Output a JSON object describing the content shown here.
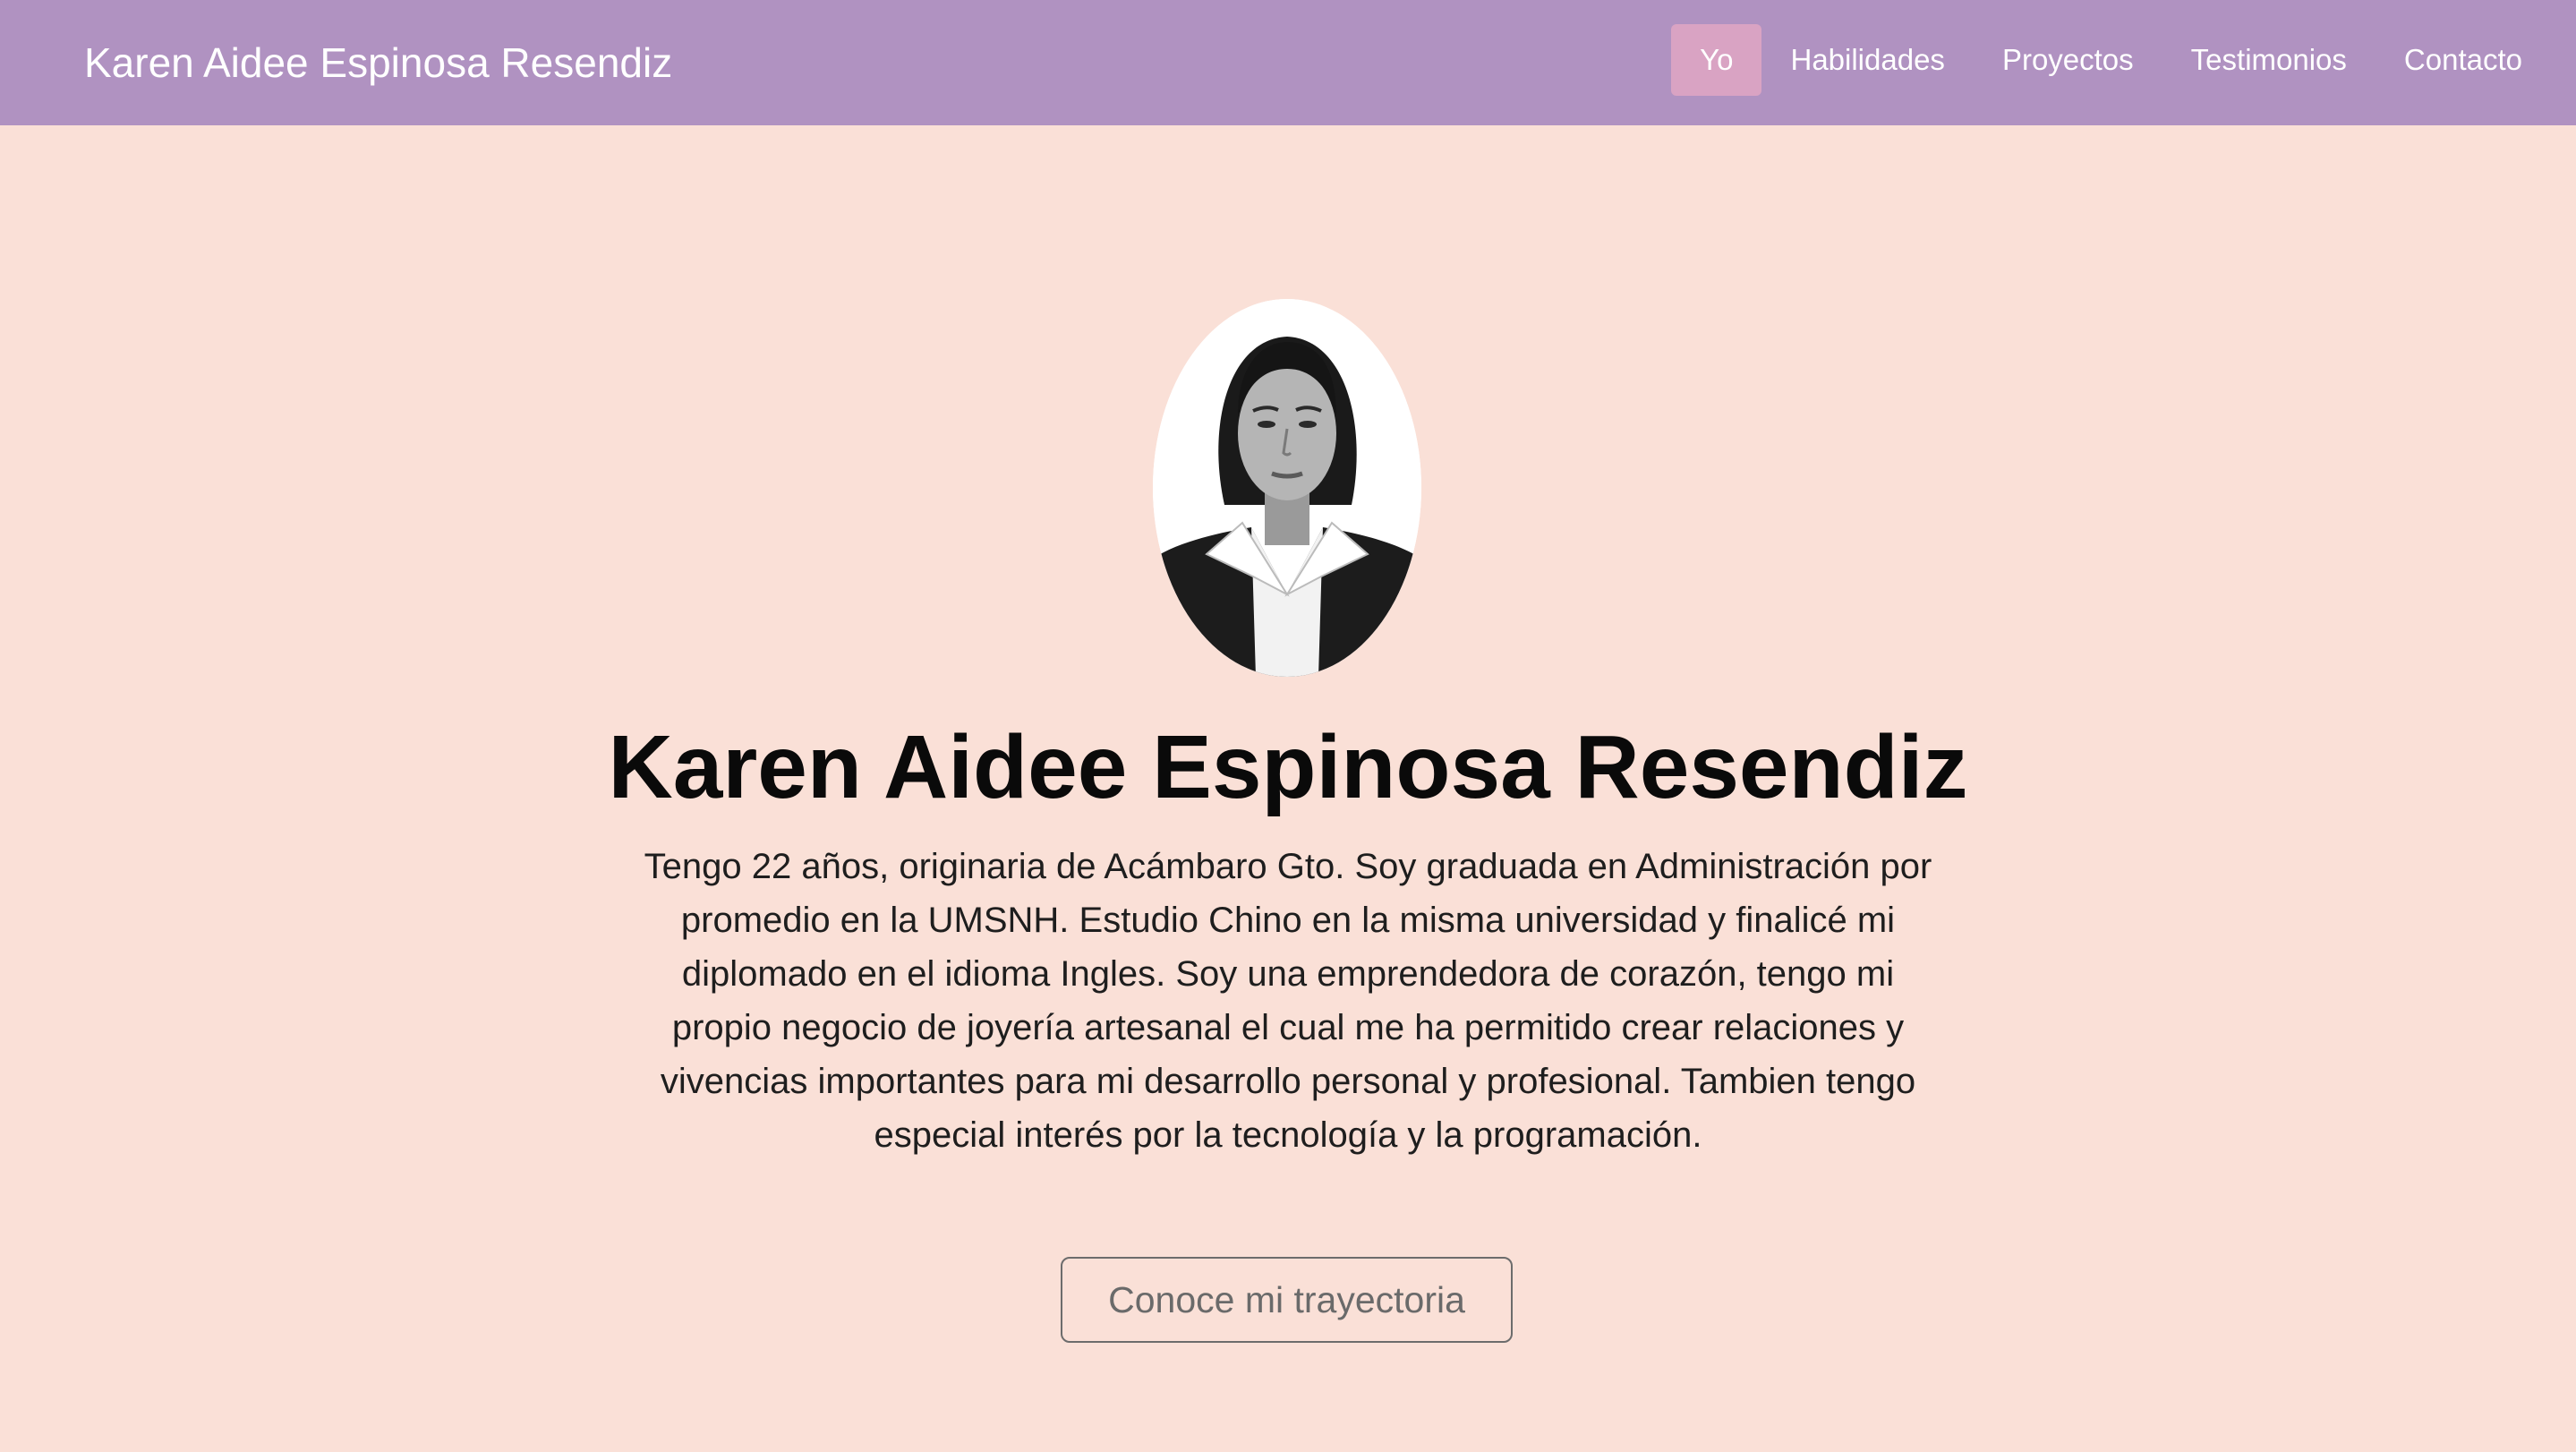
{
  "navbar": {
    "brand": "Karen Aidee Espinosa Resendiz",
    "links": [
      {
        "label": "Yo",
        "active": true
      },
      {
        "label": "Habilidades",
        "active": false
      },
      {
        "label": "Proyectos",
        "active": false
      },
      {
        "label": "Testimonios",
        "active": false
      },
      {
        "label": "Contacto",
        "active": false
      }
    ]
  },
  "hero": {
    "title": "Karen Aidee Espinosa Resendiz",
    "description": "Tengo 22 años, originaria de Acámbaro Gto. Soy graduada en Administración por promedio en la UMSNH. Estudio Chino en la misma universidad y finalicé mi diplomado en el idioma Ingles. Soy una emprendedora de corazón, tengo mi propio negocio de joyería artesanal el cual me ha permitido crear relaciones y vivencias importantes para mi desarrollo personal y profesional. Tambien tengo especial interés por la tecnología y la programación.",
    "cta_label": "Conoce mi trayectoria"
  },
  "colors": {
    "navbar_bg": "#b092c1",
    "active_link_bg": "#d9a3c3",
    "page_bg": "#fae0d7"
  }
}
